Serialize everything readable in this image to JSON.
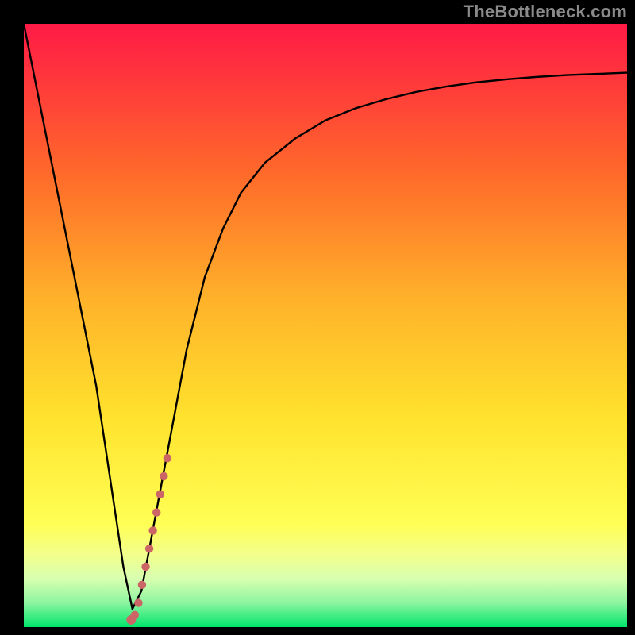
{
  "watermark": "TheBottleneck.com",
  "colors": {
    "gradient_top": "#ff1a46",
    "gradient_mid1": "#ff8a2a",
    "gradient_mid2": "#ffe22d",
    "gradient_band": "#f7ff7a",
    "gradient_bottom": "#00e56b",
    "curve": "#000000",
    "marker": "#cc6666",
    "frame": "#000000"
  },
  "chart_data": {
    "type": "line",
    "title": "",
    "xlabel": "",
    "ylabel": "",
    "xlim": [
      0,
      100
    ],
    "ylim": [
      0,
      100
    ],
    "series": [
      {
        "name": "bottleneck-curve",
        "x": [
          0,
          3,
          6,
          9,
          12,
          13.5,
          15,
          16.5,
          18,
          19.5,
          21,
          22.5,
          24,
          27,
          30,
          33,
          36,
          40,
          45,
          50,
          55,
          60,
          65,
          70,
          75,
          80,
          85,
          90,
          95,
          100
        ],
        "y": [
          100,
          85,
          70,
          55,
          40,
          30,
          20,
          10,
          3,
          6,
          14,
          22,
          30,
          46,
          58,
          66,
          72,
          77,
          81,
          84,
          86,
          87.5,
          88.7,
          89.6,
          90.3,
          90.8,
          91.2,
          91.5,
          91.7,
          91.9
        ]
      }
    ],
    "markers": {
      "name": "highlight-dots",
      "x": [
        17.8,
        18.4,
        19.0,
        19.6,
        20.2,
        20.8,
        21.4,
        22.0,
        22.6,
        23.2,
        23.8
      ],
      "y": [
        1.2,
        2.0,
        4.0,
        7.0,
        10.0,
        13.0,
        16.0,
        19.0,
        22.0,
        25.0,
        28.0
      ]
    }
  }
}
